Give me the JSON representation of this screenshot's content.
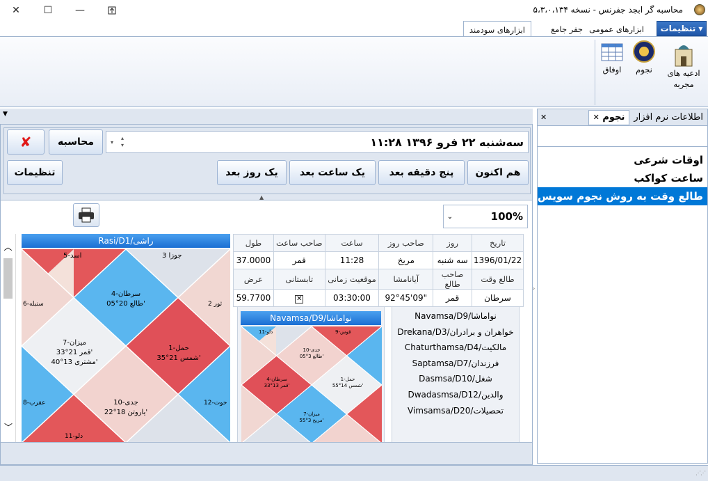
{
  "window": {
    "title": "محاسبه گر ابجد جفرنس - نسخه ۵،۳،۰،۱۳۴"
  },
  "ribbon": {
    "settings_menu": "تنظیمات",
    "tabs": [
      "ابزارهای عمومی",
      "جفر جامع",
      "ابزارهای سودمند"
    ],
    "buttons": {
      "adie": "ادعیه های مجربه",
      "nojum": "نجوم",
      "owfaq": "اوفاق"
    }
  },
  "doc_tabs": {
    "software_info": "اطلاعات نرم افزار",
    "nojum": "نجوم"
  },
  "calc": {
    "datetime": "سه‌شنبه ۲۲ فرو ۱۳۹۶ ۱۱:۲۸",
    "calculate": "محاسبه",
    "now": "هم اکنون",
    "five_min": "پنج دقیقه بعد",
    "one_hour": "یک ساعت بعد",
    "one_day": "یک روز بعد",
    "settings": "تنظیمات",
    "zoom": "100%"
  },
  "info_table": {
    "headers1": [
      "تاریخ",
      "روز",
      "صاحب روز",
      "ساعت",
      "صاحب ساعت",
      "طول"
    ],
    "values1": [
      "1396/01/22",
      "سه شنبه",
      "مریخ",
      "11:28",
      "قمر",
      "37.0000"
    ],
    "headers2": [
      "طالع وقت",
      "صاحب طالع",
      "آیانامشا",
      "موقعیت زمانی",
      "تابستانی",
      "عرض"
    ],
    "values2": [
      "سرطان",
      "قمر",
      "92°45'09\"",
      "03:30:00",
      "",
      "59.7700"
    ]
  },
  "charts": {
    "rasi_title": "Rasi/D1/راشی",
    "navamsa_title": "Navamsa/D9/نواماشا",
    "rasi_cells": {
      "top": [
        "4-سرطان",
        "طالع 20°05'"
      ],
      "center": [
        "7-میزان",
        "قمر 21°33'",
        "مشتری 13°40'"
      ],
      "right": [
        "1-حمل",
        "شمس 21°35'"
      ],
      "bottom": [
        "10-جدی",
        "یاروتن 18°22'"
      ],
      "t_left": "5-اسد",
      "t_right": "3 جوزا",
      "l_top": "6-سنبله",
      "r_top": "2 ثور",
      "l_bot": "8-عقرب",
      "r_bot": "12-حوت",
      "b_left": "11-دلو"
    },
    "navamsa_cells": {
      "top": [
        "10-جدی",
        "طالع 3°05'"
      ],
      "center": [
        "1-حمل",
        "شمس 14°55'"
      ],
      "left": [
        "4-سرطان",
        "قمر 13°33'"
      ],
      "bottom": [
        "7-میزان",
        "مریخ 3°55'"
      ],
      "t_left": "11-دلو",
      "t_right": "9-قوس"
    }
  },
  "varga_list": [
    "Navamsa/D9/نواماشا",
    "Drekana/D3/خواهران و برادران",
    "Chaturthamsa/D4/مالکیت",
    "Saptamsa/D7/فرزندان",
    "Dasmsa/D10/شغل",
    "Dwadasmsa/D12/والدین",
    "Vimsamsa/D20/تحصیلات"
  ],
  "right_list": [
    "اوقات شرعی",
    "ساعت کواکب",
    "طالع وقت به روش نجوم سویس"
  ],
  "colors": {
    "accent": "#3c78c8",
    "red": "#e0545a",
    "blue": "#59b4ef",
    "selected": "#0078d7"
  }
}
